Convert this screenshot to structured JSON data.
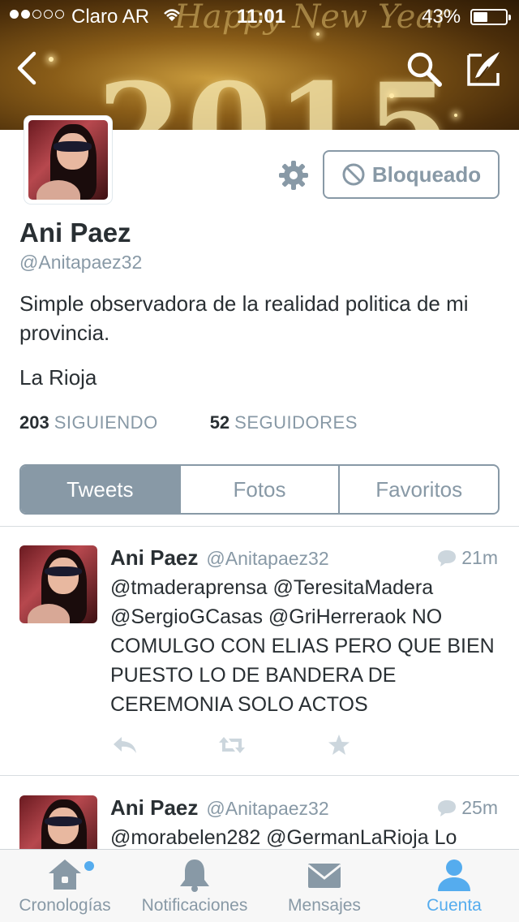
{
  "status_bar": {
    "carrier": "Claro AR",
    "time": "11:01",
    "battery_percent": "43%",
    "signal_bars": 2,
    "battery_level": 0.43
  },
  "banner": {
    "greeting": "Happy New Year",
    "year": "2015"
  },
  "nav": {
    "back_icon": "chevron-left-icon",
    "search_icon": "search-icon",
    "compose_icon": "compose-icon"
  },
  "profile": {
    "name": "Ani Paez",
    "handle": "@Anitapaez32",
    "bio": "Simple observadora de la realidad politica de mi provincia.",
    "location": "La Rioja",
    "blocked_label": "Bloqueado",
    "following_count": "203",
    "following_label": "SIGUIENDO",
    "followers_count": "52",
    "followers_label": "SEGUIDORES"
  },
  "segments": [
    {
      "label": "Tweets",
      "active": true
    },
    {
      "label": "Fotos",
      "active": false
    },
    {
      "label": "Favoritos",
      "active": false
    }
  ],
  "tweets": [
    {
      "name": "Ani Paez",
      "handle": "@Anitapaez32",
      "time": "21m",
      "text": "@tmaderaprensa @TeresitaMadera @SergioGCasas @GriHerreraok NO COMULGO CON ELIAS PERO QUE BIEN PUESTO LO DE BANDERA DE CEREMONIA SOLO ACTOS"
    },
    {
      "name": "Ani Paez",
      "handle": "@Anitapaez32",
      "time": "25m",
      "text": "@morabelen282 @GermanLaRioja Lo"
    }
  ],
  "tabbar": [
    {
      "label": "Cronologías",
      "icon": "home-icon",
      "active": false,
      "badge": true
    },
    {
      "label": "Notificaciones",
      "icon": "bell-icon",
      "active": false,
      "badge": false
    },
    {
      "label": "Mensajes",
      "icon": "envelope-icon",
      "active": false,
      "badge": false
    },
    {
      "label": "Cuenta",
      "icon": "person-icon",
      "active": true,
      "badge": false
    }
  ],
  "colors": {
    "accent": "#55acee",
    "muted": "#8899a6",
    "text": "#292f33"
  }
}
